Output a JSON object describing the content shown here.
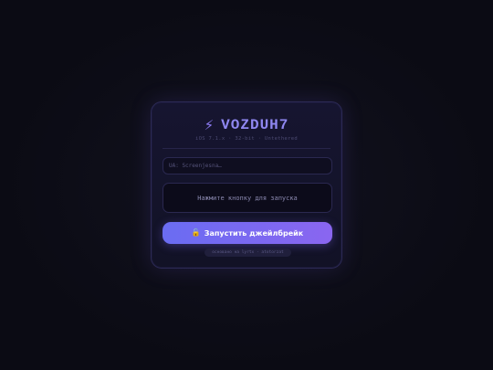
{
  "app": {
    "title": "VOZDUH7",
    "title_icon": "lightning-bolt-icon",
    "subtitle": "iOS 7.1.x · 32-bit · Untethered"
  },
  "input": {
    "value": "",
    "placeholder": "UA: Screenjesna…"
  },
  "status": {
    "message": "Нажмите кнопку для запуска"
  },
  "launch_button": {
    "icon": "lock-icon",
    "label": "Запустить джейлбрейк"
  },
  "footer": {
    "text": "основано на lyrtx · atotorzat"
  },
  "colors": {
    "background": "#0b0b14",
    "card": "#161530",
    "accent_start": "#6a6cf2",
    "accent_end": "#8a66f0",
    "title": "#8f87f0"
  }
}
